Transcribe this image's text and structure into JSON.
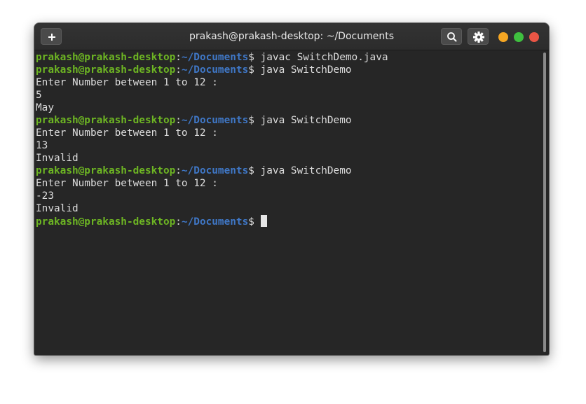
{
  "window": {
    "title": "prakash@prakash-desktop: ~/Documents",
    "new_tab_icon": "plus-icon",
    "search_icon": "search-icon",
    "menu_icon": "gear-icon",
    "controls": {
      "minimize_color": "#f5a623",
      "maximize_color": "#3fbf3f",
      "close_color": "#e95545"
    }
  },
  "prompt": {
    "user": "prakash@prakash-desktop",
    "colon": ":",
    "path": "~/Documents",
    "dollar": "$ "
  },
  "terminal": {
    "lines": [
      {
        "type": "prompt",
        "command": "javac SwitchDemo.java"
      },
      {
        "type": "prompt",
        "command": "java SwitchDemo"
      },
      {
        "type": "output",
        "text": "Enter Number between 1 to 12 :"
      },
      {
        "type": "output",
        "text": "5"
      },
      {
        "type": "output",
        "text": "May"
      },
      {
        "type": "prompt",
        "command": "java SwitchDemo"
      },
      {
        "type": "output",
        "text": "Enter Number between 1 to 12 :"
      },
      {
        "type": "output",
        "text": "13"
      },
      {
        "type": "output",
        "text": "Invalid"
      },
      {
        "type": "prompt",
        "command": "java SwitchDemo"
      },
      {
        "type": "output",
        "text": "Enter Number between 1 to 12 :"
      },
      {
        "type": "output",
        "text": "-23"
      },
      {
        "type": "output",
        "text": "Invalid"
      },
      {
        "type": "prompt",
        "command": "",
        "cursor": true
      }
    ]
  }
}
